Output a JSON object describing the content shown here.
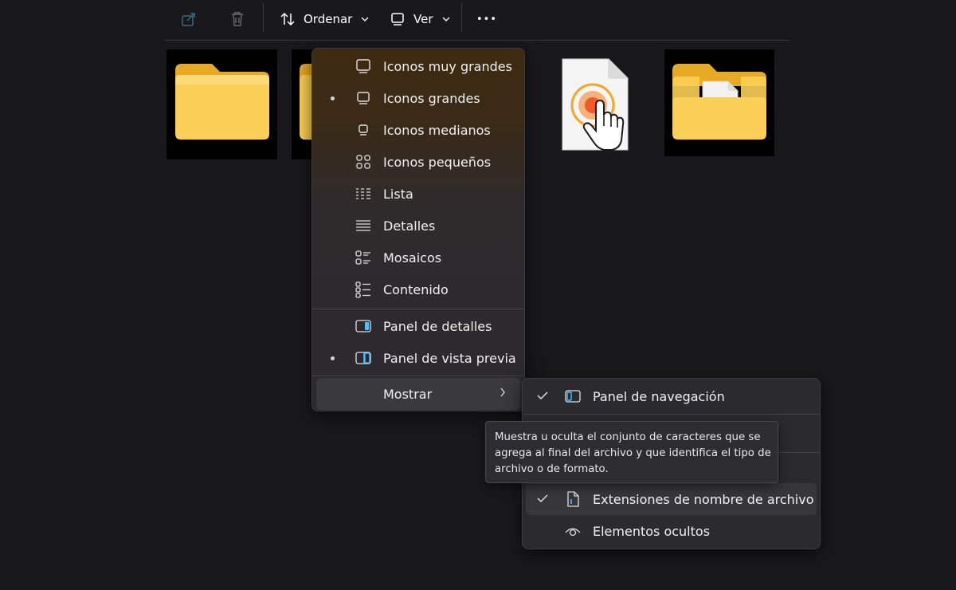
{
  "toolbar": {
    "share_icon": "share-icon",
    "delete_icon": "trash-icon",
    "sort_label": "Ordenar",
    "view_label": "Ver",
    "more_label": "•••"
  },
  "view_menu": {
    "items": [
      {
        "label": "Iconos muy grandes",
        "icon": "monitor-icon",
        "selected": false
      },
      {
        "label": "Iconos grandes",
        "icon": "monitor-icon",
        "selected": true
      },
      {
        "label": "Iconos medianos",
        "icon": "monitor-small-icon",
        "selected": false
      },
      {
        "label": "Iconos pequeños",
        "icon": "grid-icon",
        "selected": false
      },
      {
        "label": "Lista",
        "icon": "list-icon",
        "selected": false
      },
      {
        "label": "Detalles",
        "icon": "details-icon",
        "selected": false
      },
      {
        "label": "Mosaicos",
        "icon": "tiles-icon",
        "selected": false
      },
      {
        "label": "Contenido",
        "icon": "content-icon",
        "selected": false
      }
    ],
    "panels": [
      {
        "label": "Panel de detalles",
        "icon": "details-pane-icon",
        "selected": false
      },
      {
        "label": "Panel de vista previa",
        "icon": "preview-pane-icon",
        "selected": true
      }
    ],
    "show_label": "Mostrar"
  },
  "show_menu": {
    "items": [
      {
        "label": "Panel de navegación",
        "icon": "navigation-pane-icon",
        "checked": true
      },
      {
        "label": "Extensiones de nombre de archivo",
        "icon": "file-extension-icon",
        "checked": true
      },
      {
        "label": "Elementos ocultos",
        "icon": "eye-icon",
        "checked": false
      }
    ]
  },
  "tooltip": {
    "text": "Muestra u oculta el conjunto de caracteres que se agrega al final del archivo y que identifica el tipo de archivo o de formato."
  },
  "colors": {
    "background": "#19181b",
    "menu": "#2b2a2e",
    "accent": "#4cc2ff",
    "folder": "#f9cf57"
  }
}
